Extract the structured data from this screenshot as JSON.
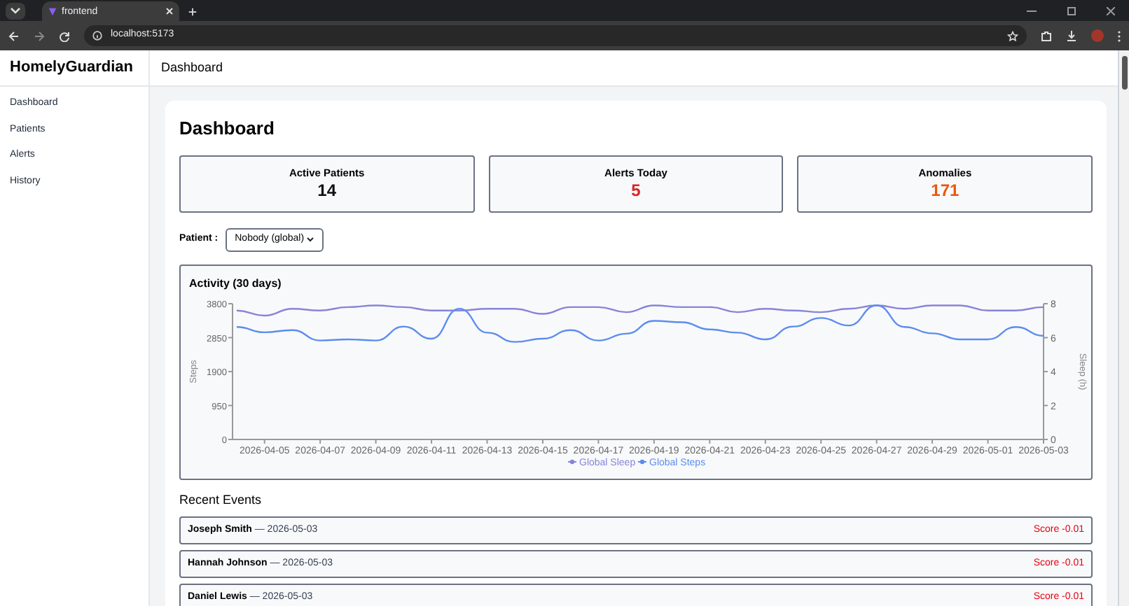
{
  "browser": {
    "tab_title": "frontend",
    "url": "localhost:5173"
  },
  "app": {
    "brand": "HomelyGuardian",
    "header_title": "Dashboard"
  },
  "sidebar": {
    "items": [
      {
        "label": "Dashboard"
      },
      {
        "label": "Patients"
      },
      {
        "label": "Alerts"
      },
      {
        "label": "History"
      }
    ]
  },
  "page_title": "Dashboard",
  "stats": [
    {
      "label": "Active Patients",
      "value": "14",
      "color": "#111111"
    },
    {
      "label": "Alerts Today",
      "value": "5",
      "color": "#dc2626"
    },
    {
      "label": "Anomalies",
      "value": "171",
      "color": "#ea580c"
    }
  ],
  "patient_filter": {
    "label": "Patient :",
    "value": "Nobody (global)"
  },
  "activity": {
    "title": "Activity (30 days)",
    "chart_data": {
      "type": "line",
      "legend": "bottom",
      "ylabel": "Steps",
      "y2label": "Sleep (h)",
      "ylim": [
        0,
        3800
      ],
      "y2lim": [
        0,
        8
      ],
      "yticks": [
        0,
        950,
        1900,
        2850,
        3800
      ],
      "y2ticks": [
        0,
        2,
        4,
        6,
        8
      ],
      "categories": [
        null,
        "2026-04-05",
        null,
        "2026-04-07",
        null,
        "2026-04-09",
        null,
        "2026-04-11",
        null,
        "2026-04-13",
        null,
        "2026-04-15",
        null,
        "2026-04-17",
        null,
        "2026-04-19",
        null,
        "2026-04-21",
        null,
        "2026-04-23",
        null,
        "2026-04-25",
        null,
        "2026-04-27",
        null,
        "2026-04-29",
        null,
        "2026-05-01",
        null,
        "2026-05-03"
      ],
      "series": [
        {
          "name": "Global Sleep",
          "color": "#8884d8",
          "axis": "y2",
          "values": [
            7.6,
            7.3,
            7.7,
            7.6,
            7.8,
            7.9,
            7.8,
            7.6,
            7.6,
            7.7,
            7.7,
            7.4,
            7.8,
            7.8,
            7.5,
            7.9,
            7.8,
            7.8,
            7.5,
            7.7,
            7.6,
            7.5,
            7.7,
            7.9,
            7.7,
            7.9,
            7.9,
            7.6,
            7.6,
            7.8
          ]
        },
        {
          "name": "Global Steps",
          "color": "#5b8def",
          "values": [
            3150,
            3000,
            3060,
            2770,
            2800,
            2770,
            3160,
            2820,
            3660,
            2990,
            2730,
            2820,
            3060,
            2770,
            2960,
            3320,
            3280,
            3080,
            2990,
            2800,
            3160,
            3400,
            3190,
            3750,
            3150,
            2970,
            2800,
            2800,
            3150,
            2900
          ]
        }
      ]
    }
  },
  "recent_events": {
    "title": "Recent Events",
    "items": [
      {
        "name": "Joseph Smith",
        "date": "— 2026-05-03",
        "score": "Score -0.01"
      },
      {
        "name": "Hannah Johnson",
        "date": "— 2026-05-03",
        "score": "Score -0.01"
      },
      {
        "name": "Daniel Lewis",
        "date": "— 2026-05-03",
        "score": "Score -0.01"
      }
    ]
  }
}
